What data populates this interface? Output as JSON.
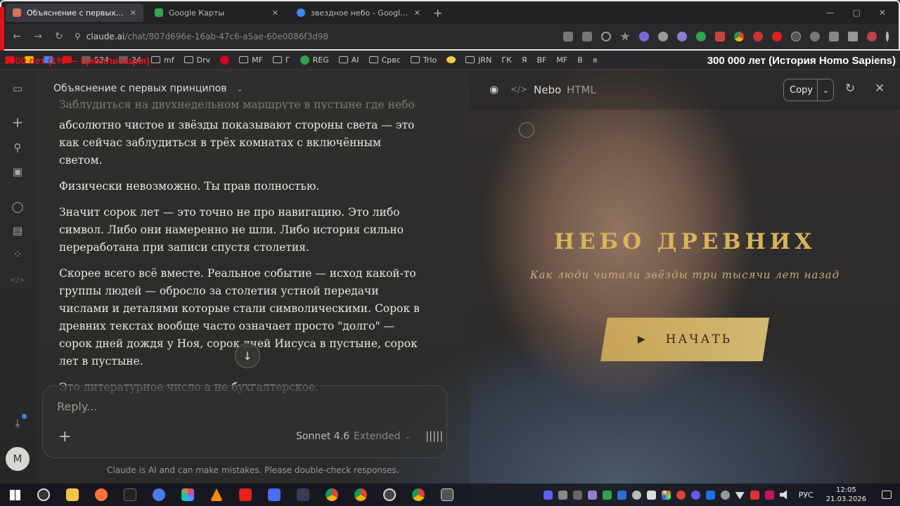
{
  "browser": {
    "tabs": [
      {
        "title": "Объяснение с первых принципо",
        "active": true,
        "favicon_color": "#d97757"
      },
      {
        "title": "Google Карты",
        "active": false,
        "favicon_color": "#34a853"
      },
      {
        "title": "звездное небо - Google Search",
        "active": false,
        "favicon_color": "#4285f4"
      }
    ],
    "new_tab": "+",
    "window_controls": [
      "—",
      "▢",
      "✕"
    ],
    "url_host": "claude.ai",
    "url_path": "/chat/807d696e-16ab-47c6-a5ae-60e0086f3d98",
    "bookmarks": [
      "524",
      "24",
      "mf",
      "Drv",
      "MF",
      "Г",
      "REG",
      "AI",
      "Срвс",
      "Trlo",
      "",
      "JRN",
      "ГК",
      "Я",
      "BF",
      "MF",
      "В",
      "я",
      "Б"
    ],
    "overlay_left": "3000 лет (1% — Цивилизация)",
    "overlay_right": "300 000 лет (История Homo Sapiens)"
  },
  "sidebar": {
    "avatar_initial": "M"
  },
  "chat": {
    "title": "Объяснение с первых принципов",
    "messages": [
      "Заблудиться на двухнедельном маршруте в пустыне где небо",
      "абсолютно чистое и звёзды показывают стороны света — это как сейчас заблудиться в трёх комнатах с включённым светом.",
      "Физически невозможно. Ты прав полностью.",
      "Значит сорок лет — это точно не про навигацию. Это либо символ. Либо они намеренно не шли. Либо история сильно переработана при записи спустя столетия.",
      "Скорее всего всё вместе. Реальное событие — исход какой-то группы людей — обросло за столетия устной передачи числами и деталями которые стали символическими. Сорок в древних текстах вообще часто означает просто \"долго\" — сорок дней дождя у Ноя, сорок дней Иисуса в пустыне, сорок лет в пустыне.",
      "Это литературное число а не бухгалтерское."
    ],
    "composer_placeholder": "Reply...",
    "model": "Sonnet 4.6",
    "mode": "Extended",
    "disclaimer": "Claude is AI and can make mistakes. Please double-check responses."
  },
  "artifact": {
    "name": "Nebo",
    "type": "HTML",
    "copy_label": "Copy",
    "title": "НЕБО ДРЕВНИХ",
    "subtitle": "Как люди читали звёзды три тысячи лет назад",
    "start_label": "НАЧАТЬ"
  },
  "taskbar": {
    "language": "РУС",
    "time": "12:05",
    "date": "21.03.2026"
  },
  "colors": {
    "accent_gold": "#d8b35a",
    "overlay_red": "#e0131b"
  }
}
